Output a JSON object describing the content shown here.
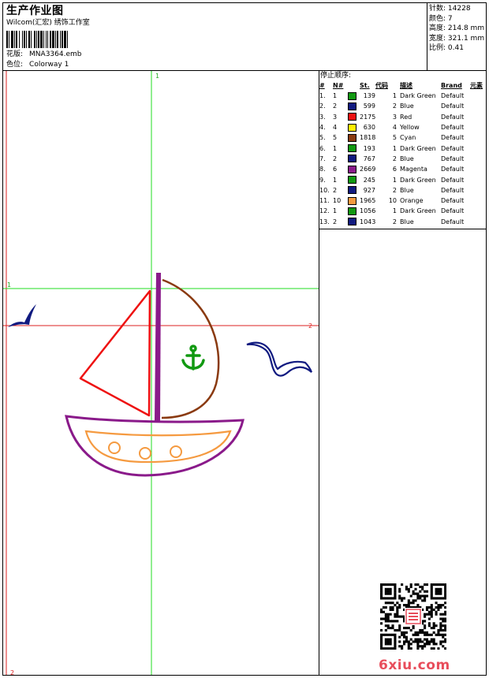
{
  "header": {
    "title": "生产作业图",
    "subtitle": "Wilcom(汇宏) 绣饰工作室",
    "design_label": "花版:",
    "design_value": "MNA3364.emb",
    "color_label": "色位:",
    "color_value": "Colorway 1"
  },
  "stats": [
    {
      "label": "针数:",
      "value": "14228"
    },
    {
      "label": "颜色:",
      "value": "7"
    },
    {
      "label": "高度:",
      "value": "214.8 mm"
    },
    {
      "label": "宽度:",
      "value": "321.1 mm"
    },
    {
      "label": "比例:",
      "value": "0.41"
    }
  ],
  "grid_markers": {
    "top": "1",
    "left": "1",
    "right": "2",
    "bottom": "2"
  },
  "sequence": {
    "title": "停止顺序:",
    "headers": {
      "idx": "#",
      "n": "N#",
      "st": "St.",
      "code": "代码",
      "desc": "描述",
      "brand": "Brand",
      "elem": "元素"
    },
    "rows": [
      {
        "idx": "1.",
        "n": "1",
        "color": "#119911",
        "st": "139",
        "code": "1",
        "desc": "Dark Green",
        "brand": "Default"
      },
      {
        "idx": "2.",
        "n": "2",
        "color": "#101a80",
        "st": "599",
        "code": "2",
        "desc": "Blue",
        "brand": "Default"
      },
      {
        "idx": "3.",
        "n": "3",
        "color": "#ee1111",
        "st": "2175",
        "code": "3",
        "desc": "Red",
        "brand": "Default"
      },
      {
        "idx": "4.",
        "n": "4",
        "color": "#ffee00",
        "st": "630",
        "code": "4",
        "desc": "Yellow",
        "brand": "Default"
      },
      {
        "idx": "5.",
        "n": "5",
        "color": "#8a3a10",
        "st": "1818",
        "code": "5",
        "desc": "Cyan",
        "brand": "Default"
      },
      {
        "idx": "6.",
        "n": "1",
        "color": "#119911",
        "st": "193",
        "code": "1",
        "desc": "Dark Green",
        "brand": "Default"
      },
      {
        "idx": "7.",
        "n": "2",
        "color": "#101a80",
        "st": "767",
        "code": "2",
        "desc": "Blue",
        "brand": "Default"
      },
      {
        "idx": "8.",
        "n": "6",
        "color": "#8a1a8a",
        "st": "2669",
        "code": "6",
        "desc": "Magenta",
        "brand": "Default"
      },
      {
        "idx": "9.",
        "n": "1",
        "color": "#119911",
        "st": "245",
        "code": "1",
        "desc": "Dark Green",
        "brand": "Default"
      },
      {
        "idx": "10.",
        "n": "2",
        "color": "#101a80",
        "st": "927",
        "code": "2",
        "desc": "Blue",
        "brand": "Default"
      },
      {
        "idx": "11.",
        "n": "10",
        "color": "#f59a40",
        "st": "1965",
        "code": "10",
        "desc": "Orange",
        "brand": "Default"
      },
      {
        "idx": "12.",
        "n": "1",
        "color": "#119911",
        "st": "1056",
        "code": "1",
        "desc": "Dark Green",
        "brand": "Default"
      },
      {
        "idx": "13.",
        "n": "2",
        "color": "#101a80",
        "st": "1043",
        "code": "2",
        "desc": "Blue",
        "brand": "Default"
      }
    ]
  },
  "watermark": "6xiu.com",
  "colors": {
    "grid_green": "#22dd22",
    "grid_red": "#dd2222",
    "red_sail": "#ee1111",
    "mast": "#8a1a8a",
    "brown_sail": "#8a3a10",
    "anchor": "#119911",
    "hull": "#8a1a8a",
    "hull_inner": "#f59a40",
    "birds": "#101a80",
    "watermark": "#e84d5b"
  }
}
